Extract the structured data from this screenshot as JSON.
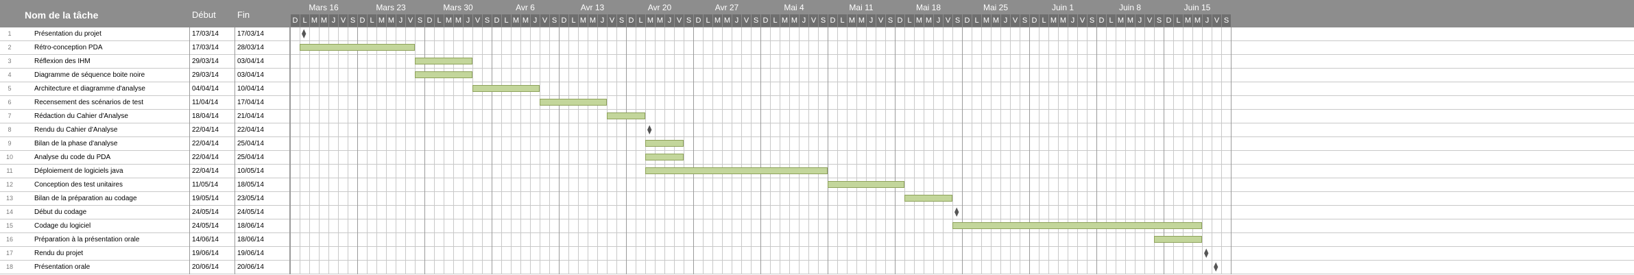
{
  "header": {
    "task_col": "Nom de la tâche",
    "start_col": "Début",
    "end_col": "Fin"
  },
  "colors": {
    "header_bg": "#8d8d8d",
    "bar_fill": "#c3d69b",
    "bar_border": "#8da15a",
    "milestone": "#555555"
  },
  "chart_data": {
    "type": "gantt",
    "timeline_start": "2014-03-16",
    "timeline_end": "2014-06-21",
    "week_labels": [
      "Mars 16",
      "Mars 23",
      "Mars 30",
      "Avr 6",
      "Avr 13",
      "Avr 20",
      "Avr 27",
      "Mai 4",
      "Mai 11",
      "Mai 18",
      "Mai 25",
      "Juin 1",
      "Juin 8",
      "Juin 15"
    ],
    "day_letters": [
      "D",
      "L",
      "M",
      "M",
      "J",
      "V",
      "S"
    ],
    "tasks": [
      {
        "id": "1",
        "name": "Présentation du projet",
        "start": "17/03/14",
        "end": "17/03/14",
        "milestone": true,
        "bar_start": "2014-03-17",
        "bar_end": "2014-03-17"
      },
      {
        "id": "2",
        "name": "Rétro-conception PDA",
        "start": "17/03/14",
        "end": "28/03/14",
        "milestone": false,
        "bar_start": "2014-03-17",
        "bar_end": "2014-03-28"
      },
      {
        "id": "3",
        "name": "Réflexion des IHM",
        "start": "29/03/14",
        "end": "03/04/14",
        "milestone": false,
        "bar_start": "2014-03-29",
        "bar_end": "2014-04-03"
      },
      {
        "id": "4",
        "name": "Diagramme de séquence boite noire",
        "start": "29/03/14",
        "end": "03/04/14",
        "milestone": false,
        "bar_start": "2014-03-29",
        "bar_end": "2014-04-03"
      },
      {
        "id": "5",
        "name": "Architecture et diagramme d'analyse",
        "start": "04/04/14",
        "end": "10/04/14",
        "milestone": false,
        "bar_start": "2014-04-04",
        "bar_end": "2014-04-10"
      },
      {
        "id": "6",
        "name": "Recensement des scénarios de test",
        "start": "11/04/14",
        "end": "17/04/14",
        "milestone": false,
        "bar_start": "2014-04-11",
        "bar_end": "2014-04-17"
      },
      {
        "id": "7",
        "name": "Rédaction du Cahier d'Analyse",
        "start": "18/04/14",
        "end": "21/04/14",
        "milestone": false,
        "bar_start": "2014-04-18",
        "bar_end": "2014-04-21"
      },
      {
        "id": "8",
        "name": "Rendu du Cahier d'Analyse",
        "start": "22/04/14",
        "end": "22/04/14",
        "milestone": true,
        "bar_start": "2014-04-22",
        "bar_end": "2014-04-22"
      },
      {
        "id": "9",
        "name": "Bilan de la phase d'analyse",
        "start": "22/04/14",
        "end": "25/04/14",
        "milestone": false,
        "bar_start": "2014-04-22",
        "bar_end": "2014-04-25"
      },
      {
        "id": "10",
        "name": "Analyse du code du PDA",
        "start": "22/04/14",
        "end": "25/04/14",
        "milestone": false,
        "bar_start": "2014-04-22",
        "bar_end": "2014-04-25"
      },
      {
        "id": "11",
        "name": "Déploiement de logiciels java",
        "start": "22/04/14",
        "end": "10/05/14",
        "milestone": false,
        "bar_start": "2014-04-22",
        "bar_end": "2014-05-10"
      },
      {
        "id": "12",
        "name": "Conception des test unitaires",
        "start": "11/05/14",
        "end": "18/05/14",
        "milestone": false,
        "bar_start": "2014-05-11",
        "bar_end": "2014-05-18"
      },
      {
        "id": "13",
        "name": "Bilan de la préparation au codage",
        "start": "19/05/14",
        "end": "23/05/14",
        "milestone": false,
        "bar_start": "2014-05-19",
        "bar_end": "2014-05-23"
      },
      {
        "id": "14",
        "name": "Début du codage",
        "start": "24/05/14",
        "end": "24/05/14",
        "milestone": true,
        "bar_start": "2014-05-24",
        "bar_end": "2014-05-24"
      },
      {
        "id": "15",
        "name": "Codage du logiciel",
        "start": "24/05/14",
        "end": "18/06/14",
        "milestone": false,
        "bar_start": "2014-05-24",
        "bar_end": "2014-06-18"
      },
      {
        "id": "16",
        "name": "Préparation à la présentation orale",
        "start": "14/06/14",
        "end": "18/06/14",
        "milestone": false,
        "bar_start": "2014-06-14",
        "bar_end": "2014-06-18"
      },
      {
        "id": "17",
        "name": "Rendu du projet",
        "start": "19/06/14",
        "end": "19/06/14",
        "milestone": true,
        "bar_start": "2014-06-19",
        "bar_end": "2014-06-19"
      },
      {
        "id": "18",
        "name": "Présentation orale",
        "start": "20/06/14",
        "end": "20/06/14",
        "milestone": true,
        "bar_start": "2014-06-20",
        "bar_end": "2014-06-20"
      }
    ]
  }
}
